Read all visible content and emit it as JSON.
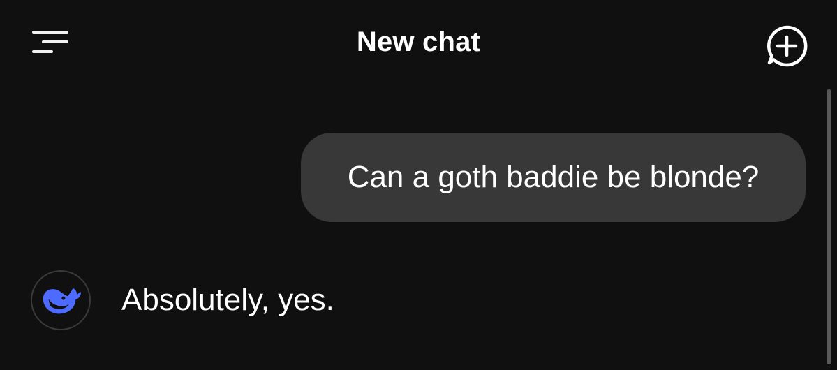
{
  "header": {
    "title": "New chat",
    "menu_icon": "hamburger-menu-icon",
    "new_chat_icon": "new-chat-plus-bubble-icon"
  },
  "conversation": {
    "messages": [
      {
        "role": "user",
        "text": "Can a goth baddie be blonde?"
      },
      {
        "role": "assistant",
        "text": "Absolutely, yes.",
        "avatar_icon": "whale-logo-icon"
      }
    ]
  },
  "colors": {
    "background": "#101010",
    "user_bubble": "#383838",
    "text": "#ffffff",
    "logo_blue": "#4d6bfe",
    "scrollbar": "#5a5a5a"
  }
}
